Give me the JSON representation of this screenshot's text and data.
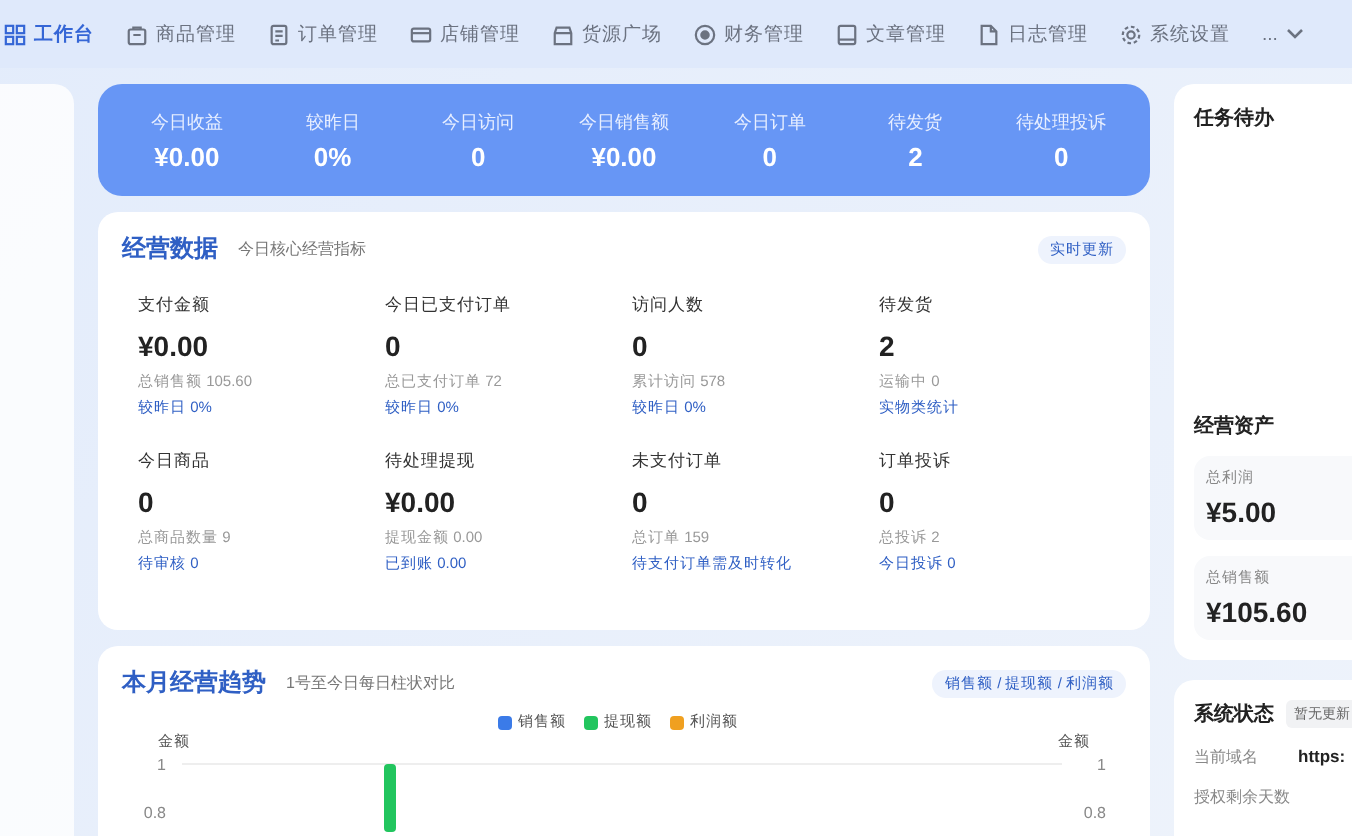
{
  "nav": [
    {
      "label": "工作台",
      "selected": true
    },
    {
      "label": "商品管理",
      "selected": false
    },
    {
      "label": "订单管理",
      "selected": false
    },
    {
      "label": "店铺管理",
      "selected": false
    },
    {
      "label": "货源广场",
      "selected": false
    },
    {
      "label": "财务管理",
      "selected": false
    },
    {
      "label": "文章管理",
      "selected": false
    },
    {
      "label": "日志管理",
      "selected": false
    },
    {
      "label": "系统设置",
      "selected": false
    },
    {
      "label": "...",
      "selected": false
    }
  ],
  "summary": [
    {
      "label": "今日收益",
      "value": "¥0.00"
    },
    {
      "label": "较昨日",
      "value": "0%"
    },
    {
      "label": "今日访问",
      "value": "0"
    },
    {
      "label": "今日销售额",
      "value": "¥0.00"
    },
    {
      "label": "今日订单",
      "value": "0"
    },
    {
      "label": "待发货",
      "value": "2"
    },
    {
      "label": "待处理投诉",
      "value": "0"
    }
  ],
  "business": {
    "title": "经营数据",
    "subtitle": "今日核心经营指标",
    "badge": "实时更新",
    "metrics": [
      {
        "label": "支付金额",
        "value": "¥0.00",
        "note": "总销售额 105.60",
        "link": "较昨日 0%"
      },
      {
        "label": "今日已支付订单",
        "value": "0",
        "note": "总已支付订单 72",
        "link": "较昨日 0%"
      },
      {
        "label": "访问人数",
        "value": "0",
        "note": "累计访问 578",
        "link": "较昨日 0%"
      },
      {
        "label": "待发货",
        "value": "2",
        "note": "运输中 0",
        "link": "实物类统计"
      },
      {
        "label": "今日商品",
        "value": "0",
        "note": "总商品数量 9",
        "link": "待审核 0"
      },
      {
        "label": "待处理提现",
        "value": "¥0.00",
        "note": "提现金额 0.00",
        "link": "已到账 0.00"
      },
      {
        "label": "未支付订单",
        "value": "0",
        "note": "总订单 159",
        "link": "待支付订单需及时转化"
      },
      {
        "label": "订单投诉",
        "value": "0",
        "note": "总投诉 2",
        "link": "今日投诉 0"
      }
    ]
  },
  "trend": {
    "title": "本月经营趋势",
    "subtitle": "1号至今日每日柱状对比",
    "badge": "销售额 / 提现额 / 利润额",
    "legend": [
      {
        "name": "销售额",
        "color": "#3b7be8"
      },
      {
        "name": "提现额",
        "color": "#22c55e"
      },
      {
        "name": "利润额",
        "color": "#f0a020"
      }
    ],
    "axis_left": {
      "title": "金额",
      "ticks": [
        "1",
        "0.8"
      ]
    },
    "axis_right": {
      "title": "金额",
      "ticks": [
        "1",
        "0.8"
      ]
    }
  },
  "tasks": {
    "title": "任务待办"
  },
  "assets": {
    "title": "经营资产",
    "items": [
      {
        "label": "总利润",
        "value": "¥5.00"
      },
      {
        "label": "总销售额",
        "value": "¥105.60"
      }
    ]
  },
  "system": {
    "title": "系统状态",
    "badge": "暂无更新",
    "rows": [
      {
        "label": "当前域名",
        "value": "https:"
      },
      {
        "label": "授权剩余天数"
      }
    ]
  }
}
